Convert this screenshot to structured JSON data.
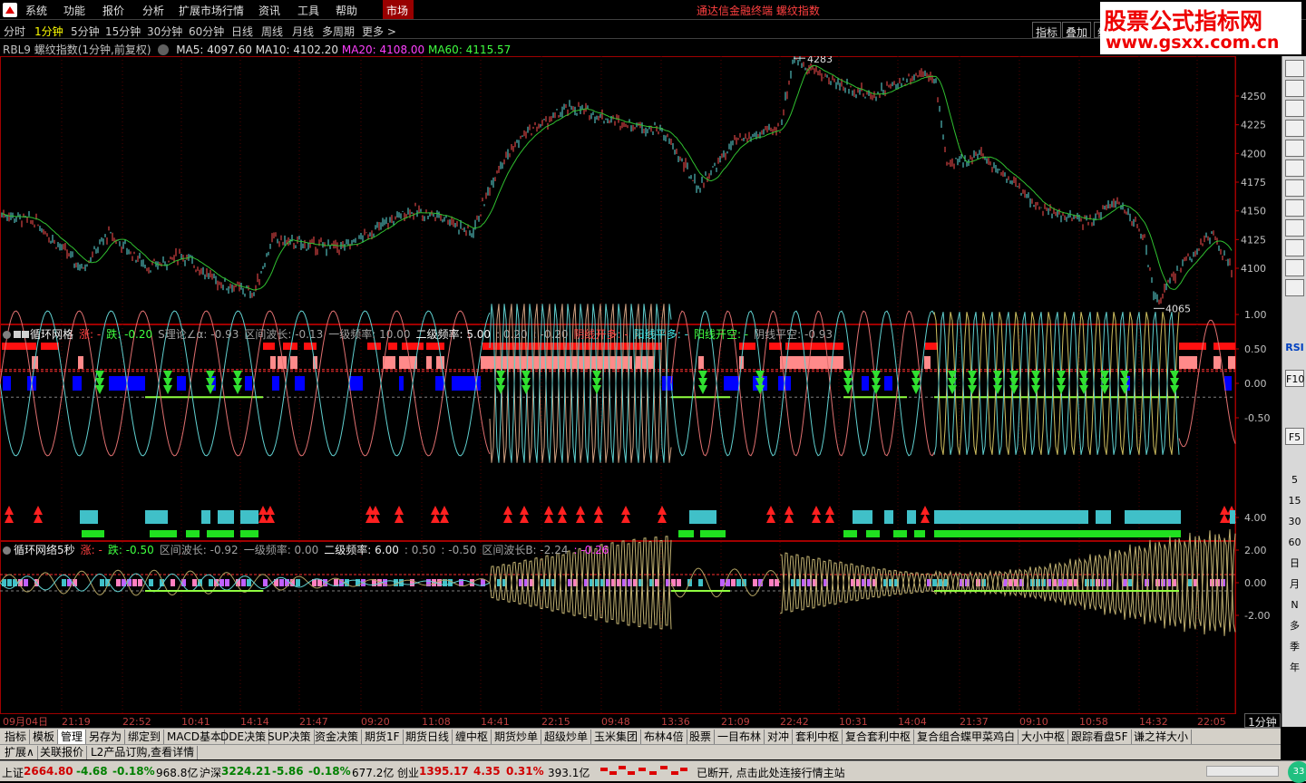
{
  "menu": {
    "items": [
      "系统",
      "功能",
      "报价",
      "分析",
      "扩展市场行情",
      "资讯",
      "工具",
      "帮助"
    ],
    "market_label": "市场",
    "app_title": "通达信金融终端  螺纹指数"
  },
  "watermark": {
    "line1": "股票公式指标网",
    "line2": "www.gsxx.com.cn"
  },
  "periods": {
    "items": [
      "分时",
      "1分钟",
      "5分钟",
      "15分钟",
      "30分钟",
      "60分钟",
      "日线",
      "周线",
      "月线",
      "多周期",
      "更多 >"
    ],
    "active": "1分钟",
    "right_buttons": [
      "指标",
      "叠加",
      "组"
    ]
  },
  "main_info": {
    "title": "RBL9 螺纹指数(1分钟,前复权)",
    "ma5": "MA5: 4097.60",
    "ma10": "MA10: 4102.20",
    "ma20": "MA20: 4108.00",
    "ma60": "MA60: 4115.57",
    "high_label": "4283",
    "low_label": "4065"
  },
  "price_axis": [
    "4250",
    "4225",
    "4200",
    "4175",
    "4150",
    "4125",
    "4100"
  ],
  "osc1_axis": [
    "1.00",
    "0.50",
    "0.00",
    "-0.50"
  ],
  "osc2_axis": [
    "4.00",
    "2.00",
    "0.00",
    "-2.00"
  ],
  "panel1": {
    "name": "循环网格",
    "items": [
      {
        "text": "涨: -",
        "cls": "c-red"
      },
      {
        "text": "跌: -0.20",
        "cls": "c-green"
      },
      {
        "text": "S理论∠α: -0.93",
        "cls": "c-gray"
      },
      {
        "text": "区间波长: -0.13",
        "cls": "c-gray"
      },
      {
        "text": "一级频率: 10.00",
        "cls": "c-gray"
      },
      {
        "text": "二级频率: 5.00",
        "cls": "c-white"
      },
      {
        "text": ": 0.20",
        "cls": "c-gray"
      },
      {
        "text": ": -0.20",
        "cls": "c-gray"
      },
      {
        "text": "阴线开多: -",
        "cls": "c-red"
      },
      {
        "text": "阳线平多: -",
        "cls": "c-cyan"
      },
      {
        "text": "阳线开空: -",
        "cls": "c-green"
      },
      {
        "text": "阴线平空: -0.93",
        "cls": "c-gray"
      }
    ]
  },
  "panel2": {
    "name": "循环网络5秒",
    "items": [
      {
        "text": "涨: -",
        "cls": "c-red"
      },
      {
        "text": "跌: -0.50",
        "cls": "c-green"
      },
      {
        "text": "区间波长: -0.92",
        "cls": "c-gray"
      },
      {
        "text": "一级频率: 0.00",
        "cls": "c-gray"
      },
      {
        "text": "二级频率: 6.00",
        "cls": "c-white"
      },
      {
        "text": ": 0.50",
        "cls": "c-gray"
      },
      {
        "text": ": -0.50",
        "cls": "c-gray"
      },
      {
        "text": "区间波长B: -2.24",
        "cls": "c-gray"
      },
      {
        "text": ": -0.26",
        "cls": "c-mag"
      }
    ]
  },
  "time_axis": [
    "09月04日",
    "21:19",
    "22:52",
    "10:41",
    "14:14",
    "21:47",
    "09:20",
    "11:08",
    "14:41",
    "22:15",
    "09:48",
    "13:36",
    "21:09",
    "22:42",
    "10:31",
    "14:04",
    "21:37",
    "09:10",
    "10:58",
    "14:32",
    "22:05"
  ],
  "period_indicator": "1分钟",
  "right_toolbar": [
    "5",
    "15",
    "30",
    "60",
    "日",
    "月",
    "N",
    "多",
    "季",
    "年"
  ],
  "right_toolbar_icons": [
    "RSI",
    "F10",
    "F5"
  ],
  "bottom_tabs": [
    "指标",
    "模板",
    "管理",
    "另存为",
    "绑定到",
    "MACD基本",
    "DDE决策",
    "SUP决策",
    "资金决策",
    "期货1F",
    "期货日线",
    "缠中枢",
    "期货炒单",
    "超级炒单",
    "玉米集团",
    "布林4倍",
    "股票",
    "一目布林",
    "对冲",
    "套利中枢",
    "复合套利中枢",
    "复合组合蝶甲菜鸡白",
    "大小中枢",
    "跟踪看盘5F",
    "谦之祥大小"
  ],
  "bottom_tabs_active": "管理",
  "sub_tabs": [
    "扩展∧",
    "关联报价",
    "L2产品订购,查看详情"
  ],
  "status": {
    "sh_label": "上证",
    "sh_val": "2664.80",
    "sh_chg": "-4.68",
    "sh_pct": "-0.18%",
    "sh_amt": "968.8亿",
    "sz_label": "沪深",
    "sz_val": "3224.21",
    "sz_chg": "-5.86",
    "sz_pct": "-0.18%",
    "sz_amt": "677.2亿",
    "cy_label": "创业",
    "cy_val": "1395.17",
    "cy_chg": "4.35",
    "cy_pct": "0.31%",
    "cy_amt": "393.1亿",
    "message": "已断开, 点击此处连接行情主站",
    "round": "33"
  },
  "colors": {
    "up": "#ff3030",
    "down": "#30ff30",
    "ma20": "#30c030",
    "blue": "#0000ff",
    "cyan": "#40c0c8",
    "pink": "#ff8080"
  }
}
